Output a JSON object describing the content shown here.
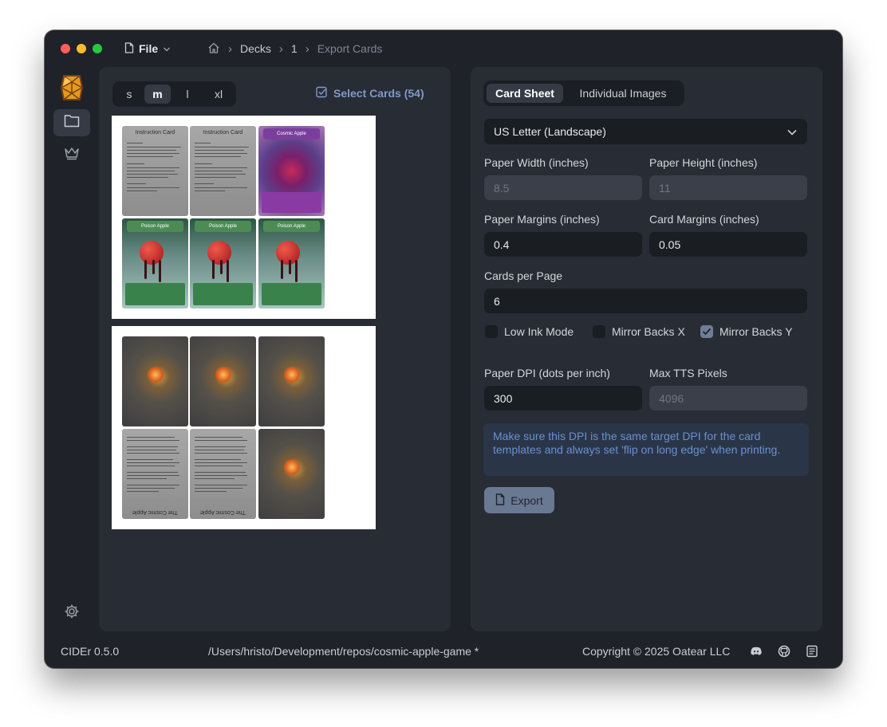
{
  "titlebar": {
    "menu_label": "File",
    "breadcrumb": [
      "Decks",
      "1",
      "Export Cards"
    ]
  },
  "sidebar": {
    "items": [
      {
        "icon": "folder-icon",
        "active": true
      },
      {
        "icon": "crown-icon",
        "active": false
      }
    ]
  },
  "left_panel": {
    "size_options": [
      "s",
      "m",
      "l",
      "xl"
    ],
    "size_selected": "m",
    "select_cards_label": "Select Cards (54)",
    "instruction_title": "Instruction Card",
    "cosmic_title": "Cosmic Apple",
    "poison_title": "Poison Apple",
    "back_title": "The Cosmic Apple"
  },
  "right_panel": {
    "tabs": [
      "Card Sheet",
      "Individual Images"
    ],
    "tab_selected": "Card Sheet",
    "paper_size": "US Letter (Landscape)",
    "paper_width_label": "Paper Width (inches)",
    "paper_width_value": "8.5",
    "paper_height_label": "Paper Height (inches)",
    "paper_height_value": "11",
    "paper_margins_label": "Paper Margins (inches)",
    "paper_margins_value": "0.4",
    "card_margins_label": "Card Margins (inches)",
    "card_margins_value": "0.05",
    "cards_per_page_label": "Cards per Page",
    "cards_per_page_value": "6",
    "low_ink_label": "Low Ink Mode",
    "low_ink_checked": false,
    "mirror_x_label": "Mirror Backs X",
    "mirror_x_checked": false,
    "mirror_y_label": "Mirror Backs Y",
    "mirror_y_checked": true,
    "paper_dpi_label": "Paper DPI (dots per inch)",
    "paper_dpi_value": "300",
    "max_tts_label": "Max TTS Pixels",
    "max_tts_value": "4096",
    "info_text": "Make sure this DPI is the same target DPI for the card templates and always set 'flip on long edge' when printing.",
    "export_label": "Export"
  },
  "statusbar": {
    "version": "CIDEr 0.5.0",
    "path": "/Users/hristo/Development/repos/cosmic-apple-game *",
    "copyright": "Copyright © 2025 Oatear LLC"
  },
  "colors": {
    "window_bg": "#1f2229",
    "panel_bg": "#282c35",
    "accent_text": "#7d9ac8",
    "button_bg": "#6a7992"
  }
}
